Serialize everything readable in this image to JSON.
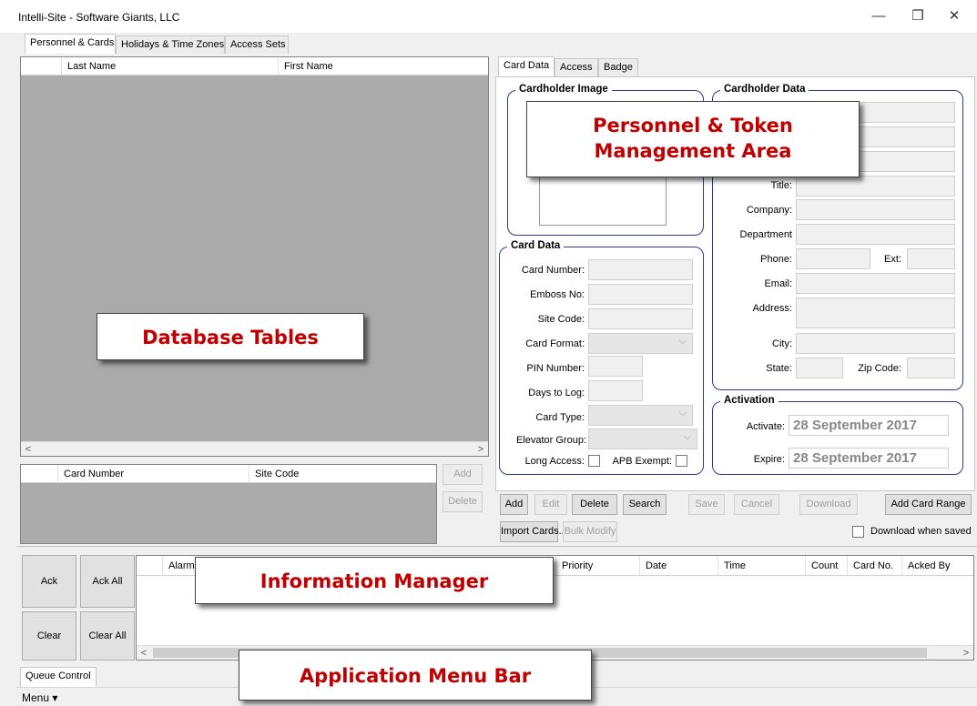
{
  "window": {
    "title": "Intelli-Site - Software Giants, LLC",
    "minimize": "—",
    "restore": "❐",
    "close": "✕"
  },
  "main_tabs": [
    "Personnel & Cards",
    "Holidays & Time Zones",
    "Access Sets"
  ],
  "personnel_grid": {
    "columns": [
      "Last Name",
      "First Name"
    ]
  },
  "card_grid": {
    "columns": [
      "Card Number",
      "Site Code"
    ]
  },
  "card_grid_buttons": {
    "add": "Add",
    "delete": "Delete"
  },
  "scroll": {
    "left": "<",
    "right": ">"
  },
  "detail_tabs": [
    "Card Data",
    "Access",
    "Badge"
  ],
  "cardholder_image": {
    "title": "Cardholder Image"
  },
  "cardholder_data": {
    "title": "Cardholder Data",
    "title_label": "Title:",
    "company_label": "Company:",
    "department_label": "Department",
    "phone_label": "Phone:",
    "ext_label": "Ext:",
    "email_label": "Email:",
    "address_label": "Address:",
    "city_label": "City:",
    "state_label": "State:",
    "zip_label": "Zip Code:"
  },
  "card_data": {
    "title": "Card Data",
    "card_number_label": "Card Number:",
    "emboss_label": "Emboss No:",
    "site_code_label": "Site Code:",
    "card_format_label": "Card Format:",
    "pin_label": "PIN Number:",
    "days_label": "Days to Log:",
    "card_type_label": "Card Type:",
    "elevator_label": "Elevator Group:",
    "long_access_label": "Long Access:",
    "apb_label": "APB Exempt:"
  },
  "activation": {
    "title": "Activation",
    "activate_label": "Activate:",
    "activate_value": "28 September 2017",
    "expire_label": "Expire:",
    "expire_value": "28 September 2017"
  },
  "toolbar": {
    "add": "Add",
    "edit": "Edit",
    "delete": "Delete",
    "search": "Search",
    "save": "Save",
    "cancel": "Cancel",
    "download": "Download",
    "add_card_range": "Add Card Range",
    "import_cards": "Import Cards...",
    "bulk_modify": "Bulk Modify",
    "download_when_saved": "Download when saved"
  },
  "alarm_buttons": {
    "ack": "Ack",
    "ack_all": "Ack All",
    "clear": "Clear",
    "clear_all": "Clear All"
  },
  "alarm_grid": {
    "columns": [
      "Alarm D",
      "Priority",
      "Date",
      "Time",
      "Count",
      "Card No.",
      "Acked By"
    ]
  },
  "bottom_tab": "Queue Control",
  "menu": {
    "label": "Menu ▾"
  },
  "callouts": {
    "database": "Database Tables",
    "personnel_line1": "Personnel & Token",
    "personnel_line2": "Management Area",
    "info": "Information Manager",
    "menu_bar": "Application Menu Bar"
  }
}
